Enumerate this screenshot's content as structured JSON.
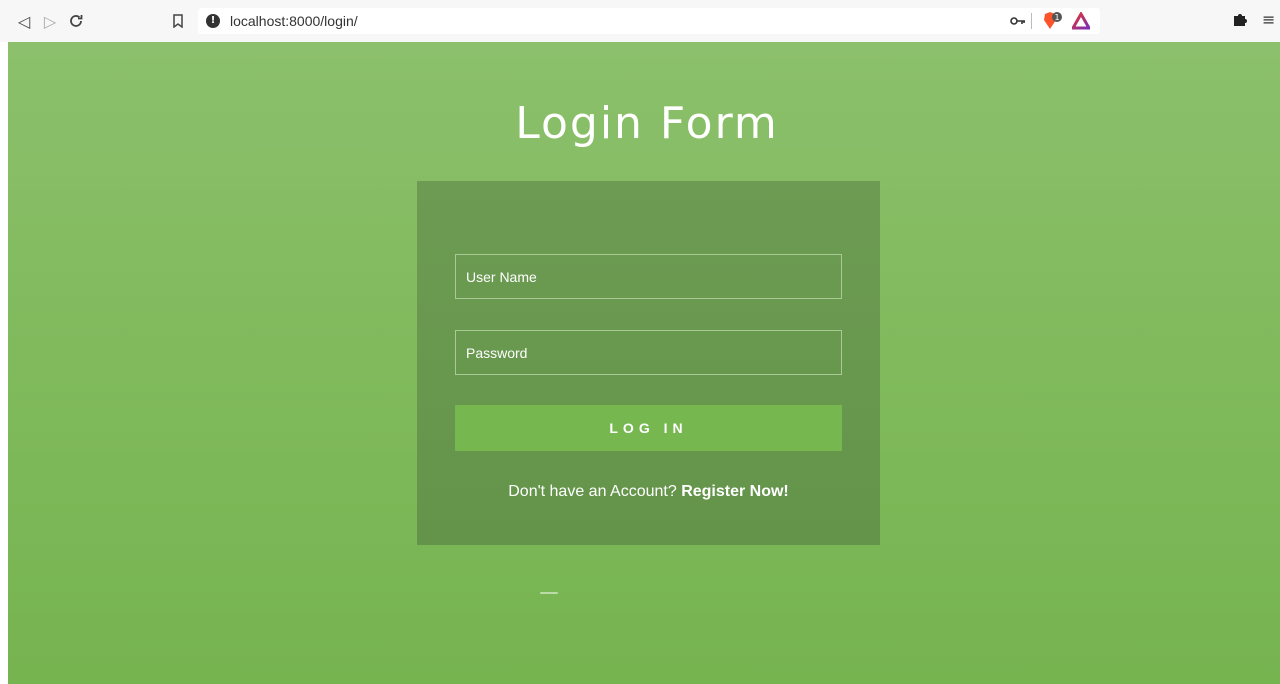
{
  "browser": {
    "back_icon": "◁",
    "forward_icon": "▷",
    "reload_icon": "C",
    "bookmark_icon": "bookmark-icon",
    "url": "localhost:8000/login/",
    "key_icon": "key-icon",
    "brave_badge": "1"
  },
  "page": {
    "title": "Login Form"
  },
  "form": {
    "username_placeholder": "User Name",
    "password_placeholder": "Password",
    "login_label": "LOG IN",
    "register_prompt": "Don't have an Account? ",
    "register_link": "Register Now!"
  },
  "colors": {
    "accent": "#76b84f",
    "card": "#6a9950",
    "background": "#84bd62"
  }
}
